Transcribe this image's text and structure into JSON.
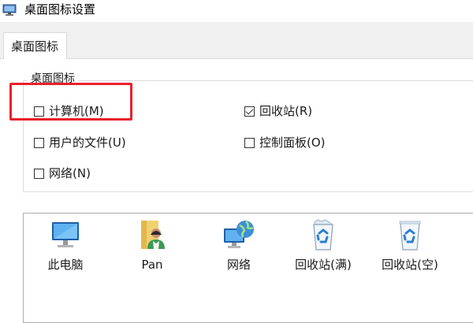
{
  "window": {
    "title": "桌面图标设置"
  },
  "tabs": [
    {
      "label": "桌面图标",
      "selected": true
    }
  ],
  "group": {
    "legend": "桌面图标",
    "checkboxes": [
      {
        "label": "计算机(M)",
        "checked": false,
        "highlighted": true
      },
      {
        "label": "回收站(R)",
        "checked": true
      },
      {
        "label": "用户的文件(U)",
        "checked": false
      },
      {
        "label": "控制面板(O)",
        "checked": false
      },
      {
        "label": "网络(N)",
        "checked": false
      }
    ]
  },
  "icons": [
    {
      "label": "此电脑",
      "icon": "monitor-icon"
    },
    {
      "label": "Pan",
      "icon": "user-folder-icon"
    },
    {
      "label": "网络",
      "icon": "network-globe-icon"
    },
    {
      "label": "回收站(满)",
      "icon": "recycle-bin-full-icon"
    },
    {
      "label": "回收站(空)",
      "icon": "recycle-bin-empty-icon"
    }
  ],
  "colors": {
    "highlight": "#e8212a",
    "tab_bar": "#f0f0f0",
    "recycle_blue": "#2b7fd4"
  }
}
